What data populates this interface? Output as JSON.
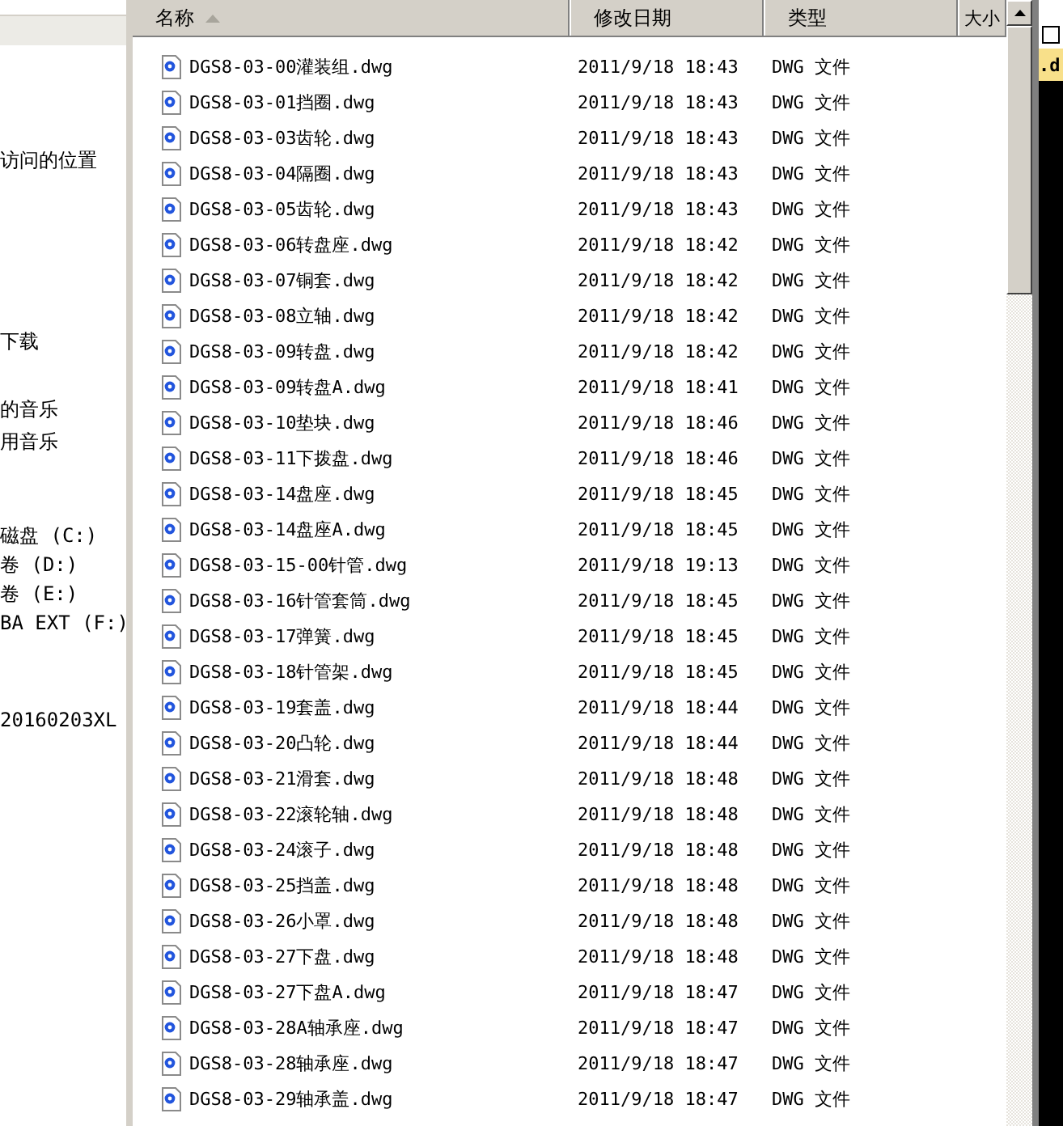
{
  "sidebar": {
    "items": [
      {
        "label": "访问的位置"
      },
      {
        "label": "下载"
      },
      {
        "label": "的音乐"
      },
      {
        "label": "用音乐"
      },
      {
        "label": "磁盘 (C:)"
      },
      {
        "label": "卷 (D:)"
      },
      {
        "label": "卷 (E:)"
      },
      {
        "label": "BA EXT (F:)"
      },
      {
        "label": "20160203XL"
      }
    ]
  },
  "table": {
    "columns": [
      {
        "label": "名称",
        "sorted": true
      },
      {
        "label": "修改日期",
        "sorted": false
      },
      {
        "label": "类型",
        "sorted": false
      },
      {
        "label": "大小",
        "sorted": false
      }
    ],
    "rows": [
      {
        "name": "DGS8-03-00灌装组.dwg",
        "modified": "2011/9/18 18:43",
        "type": "DWG 文件"
      },
      {
        "name": "DGS8-03-01挡圈.dwg",
        "modified": "2011/9/18 18:43",
        "type": "DWG 文件"
      },
      {
        "name": "DGS8-03-03齿轮.dwg",
        "modified": "2011/9/18 18:43",
        "type": "DWG 文件"
      },
      {
        "name": "DGS8-03-04隔圈.dwg",
        "modified": "2011/9/18 18:43",
        "type": "DWG 文件"
      },
      {
        "name": "DGS8-03-05齿轮.dwg",
        "modified": "2011/9/18 18:43",
        "type": "DWG 文件"
      },
      {
        "name": "DGS8-03-06转盘座.dwg",
        "modified": "2011/9/18 18:42",
        "type": "DWG 文件"
      },
      {
        "name": "DGS8-03-07铜套.dwg",
        "modified": "2011/9/18 18:42",
        "type": "DWG 文件"
      },
      {
        "name": "DGS8-03-08立轴.dwg",
        "modified": "2011/9/18 18:42",
        "type": "DWG 文件"
      },
      {
        "name": "DGS8-03-09转盘.dwg",
        "modified": "2011/9/18 18:42",
        "type": "DWG 文件"
      },
      {
        "name": "DGS8-03-09转盘A.dwg",
        "modified": "2011/9/18 18:41",
        "type": "DWG 文件"
      },
      {
        "name": "DGS8-03-10垫块.dwg",
        "modified": "2011/9/18 18:46",
        "type": "DWG 文件"
      },
      {
        "name": "DGS8-03-11下拨盘.dwg",
        "modified": "2011/9/18 18:46",
        "type": "DWG 文件"
      },
      {
        "name": "DGS8-03-14盘座.dwg",
        "modified": "2011/9/18 18:45",
        "type": "DWG 文件"
      },
      {
        "name": "DGS8-03-14盘座A.dwg",
        "modified": "2011/9/18 18:45",
        "type": "DWG 文件"
      },
      {
        "name": "DGS8-03-15-00针管.dwg",
        "modified": "2011/9/18 19:13",
        "type": "DWG 文件"
      },
      {
        "name": "DGS8-03-16针管套筒.dwg",
        "modified": "2011/9/18 18:45",
        "type": "DWG 文件"
      },
      {
        "name": "DGS8-03-17弹簧.dwg",
        "modified": "2011/9/18 18:45",
        "type": "DWG 文件"
      },
      {
        "name": "DGS8-03-18针管架.dwg",
        "modified": "2011/9/18 18:45",
        "type": "DWG 文件"
      },
      {
        "name": "DGS8-03-19套盖.dwg",
        "modified": "2011/9/18 18:44",
        "type": "DWG 文件"
      },
      {
        "name": "DGS8-03-20凸轮.dwg",
        "modified": "2011/9/18 18:44",
        "type": "DWG 文件"
      },
      {
        "name": "DGS8-03-21滑套.dwg",
        "modified": "2011/9/18 18:48",
        "type": "DWG 文件"
      },
      {
        "name": "DGS8-03-22滚轮轴.dwg",
        "modified": "2011/9/18 18:48",
        "type": "DWG 文件"
      },
      {
        "name": "DGS8-03-24滚子.dwg",
        "modified": "2011/9/18 18:48",
        "type": "DWG 文件"
      },
      {
        "name": "DGS8-03-25挡盖.dwg",
        "modified": "2011/9/18 18:48",
        "type": "DWG 文件"
      },
      {
        "name": "DGS8-03-26小罩.dwg",
        "modified": "2011/9/18 18:48",
        "type": "DWG 文件"
      },
      {
        "name": "DGS8-03-27下盘.dwg",
        "modified": "2011/9/18 18:48",
        "type": "DWG 文件"
      },
      {
        "name": "DGS8-03-27下盘A.dwg",
        "modified": "2011/9/18 18:47",
        "type": "DWG 文件"
      },
      {
        "name": "DGS8-03-28A轴承座.dwg",
        "modified": "2011/9/18 18:47",
        "type": "DWG 文件"
      },
      {
        "name": "DGS8-03-28轴承座.dwg",
        "modified": "2011/9/18 18:47",
        "type": "DWG 文件"
      },
      {
        "name": "DGS8-03-29轴承盖.dwg",
        "modified": "2011/9/18 18:47",
        "type": "DWG 文件"
      }
    ]
  },
  "side_window": {
    "checked": false,
    "text": ".d"
  }
}
